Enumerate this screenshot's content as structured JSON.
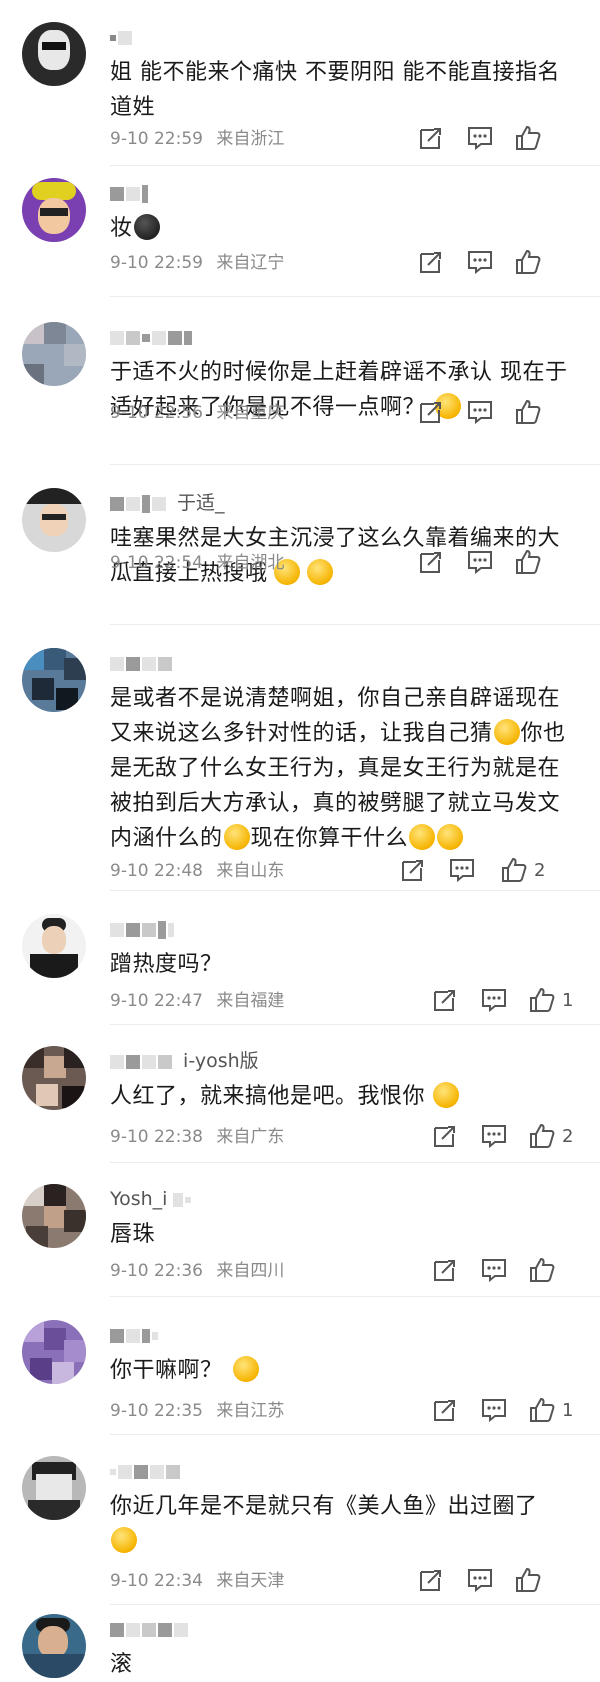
{
  "comments": [
    {
      "user": "",
      "text": "姐 能不能来个痛快 不要阴阳 能不能直接指名道姓",
      "emojis": [],
      "time": "9-10 22:59",
      "location": "来自浙江",
      "likes": ""
    },
    {
      "user": "",
      "text": "妆",
      "emojis": [
        "face-icon"
      ],
      "time": "9-10 22:59",
      "location": "来自辽宁",
      "likes": ""
    },
    {
      "user": "",
      "text": "于适不火的时候你是上赶着辟谣不承认 现在于适好起来了你是见不得一点啊？",
      "emojis": [
        "face-icon"
      ],
      "time": "9-10 22:56",
      "location": "来自重庆",
      "likes": ""
    },
    {
      "user": "于适_",
      "text": "哇塞果然是大女主沉浸了这么久靠着编来的大瓜直接上热搜哦",
      "emojis": [
        "face-icon",
        "face-icon"
      ],
      "time": "9-10 22:54",
      "location": "来自湖北",
      "likes": ""
    },
    {
      "user": "",
      "text": "是或者不是说清楚啊姐，你自己亲自辟谣现在又来说这么多针对性的话，让我自己猜",
      "text2": "你也是无敌了什么女王行为，真是女王行为就是在被拍到后大方承认，真的被劈腿了就立马发文内涵什么的",
      "text3": "现在你算干什么",
      "emojis": [
        "laugh-icon"
      ],
      "time": "9-10 22:48",
      "location": "来自山东",
      "likes": "2"
    },
    {
      "user": "",
      "text": "蹭热度吗？",
      "emojis": [],
      "time": "9-10 22:47",
      "location": "来自福建",
      "likes": "1"
    },
    {
      "user": "i-yosh版",
      "text": "人红了，就来搞他是吧。我恨你",
      "emojis": [
        "face-icon"
      ],
      "time": "9-10 22:38",
      "location": "来自广东",
      "likes": "2"
    },
    {
      "user": "Yosh_i",
      "text": "唇珠",
      "emojis": [],
      "time": "9-10 22:36",
      "location": "来自四川",
      "likes": ""
    },
    {
      "user": "",
      "text": "你干嘛啊？",
      "emojis": [
        "face-icon"
      ],
      "time": "9-10 22:35",
      "location": "来自江苏",
      "likes": "1"
    },
    {
      "user": "",
      "text": "你近几年是不是就只有《美人鱼》出过圈了",
      "emojis": [
        "face-icon"
      ],
      "time": "9-10 22:34",
      "location": "来自天津",
      "likes": ""
    },
    {
      "user": "",
      "text": "滚",
      "emojis": [],
      "time": "",
      "location": "",
      "likes": ""
    }
  ],
  "icons": {
    "repost": "repost-icon",
    "comment": "comment-icon",
    "like": "like-icon"
  },
  "colors": {
    "meta": "#8a8a8a",
    "text": "#1a1a1a",
    "separator": "#ececec"
  }
}
